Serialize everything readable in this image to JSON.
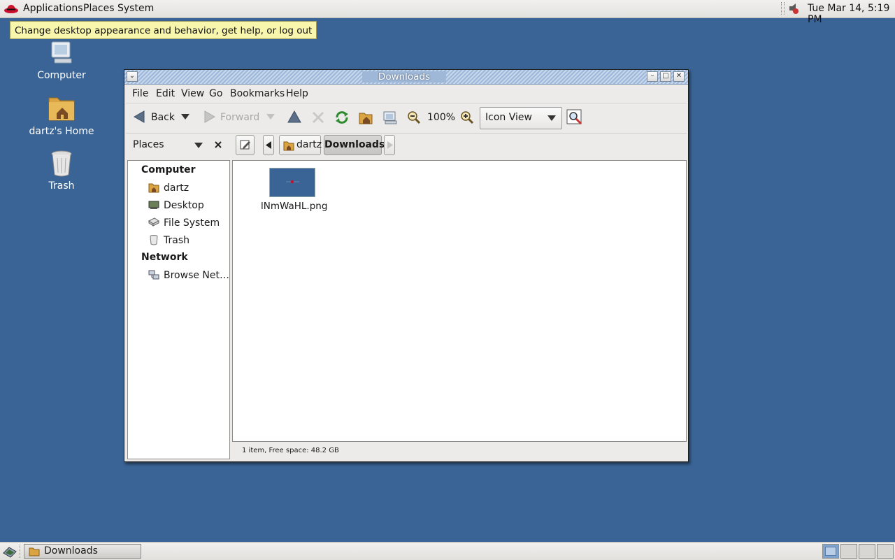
{
  "top_panel": {
    "menus": [
      "Applications",
      "Places",
      "System"
    ],
    "clock": "Tue Mar 14,  5:19 PM",
    "tooltip": "Change desktop appearance and behavior, get help, or log out"
  },
  "desktop": {
    "icons": [
      {
        "label": "Computer",
        "icon": "computer-icon"
      },
      {
        "label": "dartz's Home",
        "icon": "home-folder-icon"
      },
      {
        "label": "Trash",
        "icon": "trash-icon"
      }
    ]
  },
  "window": {
    "title": "Downloads",
    "menubar": [
      "File",
      "Edit",
      "View",
      "Go",
      "Bookmarks",
      "Help"
    ],
    "toolbar": {
      "back_label": "Back",
      "forward_label": "Forward",
      "zoom": "100%",
      "view_mode": "Icon View"
    },
    "sidebar": {
      "title": "Places",
      "sections": [
        {
          "heading": "Computer",
          "items": [
            "dartz",
            "Desktop",
            "File System",
            "Trash"
          ]
        },
        {
          "heading": "Network",
          "items": [
            "Browse Net…"
          ]
        }
      ]
    },
    "path": [
      "dartz",
      "Downloads"
    ],
    "files": [
      {
        "name": "lNmWaHL.png"
      }
    ],
    "status": "1 item, Free space: 48.2 GB"
  },
  "bottom_panel": {
    "task": "Downloads"
  },
  "colors": {
    "desktop": "#3a6496",
    "titlebar": "#9db8da"
  }
}
